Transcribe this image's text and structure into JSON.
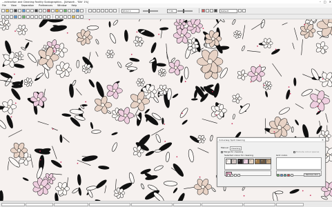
{
  "window": {
    "title": "...ectraction and Cleaning Facility Scalographics - [Artwork - 'Silk' 1%]",
    "controls": [
      "–",
      "□",
      "✕"
    ]
  },
  "menu": [
    "File",
    "View",
    "Separation",
    "Preferences",
    "Window",
    "Help"
  ],
  "toolbar": {
    "zoom_value": "63.12 1",
    "size_value": "7 34",
    "palette_select": "Default"
  },
  "dialog": {
    "title": "Colourway Spot Cleaning",
    "tabs": [
      "Manual",
      "Cleaning"
    ],
    "merge_label": "Merge for cleaning",
    "selected_label": "Selected colour for cleaning",
    "grid_label": "Grid colors",
    "no_colors_label": "Exclude colour spaces",
    "remove_label": "Remove color",
    "colors": [
      {
        "num": "1",
        "hex": "#f7f1ee"
      },
      {
        "num": "2",
        "hex": "#d4c7c4"
      },
      {
        "num": "3",
        "hex": "#2a2326"
      },
      {
        "num": "4",
        "hex": "#f0d3e4"
      },
      {
        "num": "5",
        "hex": "#e8d6c4"
      },
      {
        "num": "6",
        "hex": "#a07a4a"
      },
      {
        "num": "7",
        "hex": "#6b5842"
      },
      {
        "num": "8",
        "hex": "#c2a37e"
      }
    ],
    "selected_color": {
      "num": "6",
      "hex": "#efa9c8"
    }
  },
  "colors": {
    "background": "#f6f1ef",
    "ink": "#111111",
    "rose": "#e8d3c6",
    "pink": "#efcfe0",
    "dot": "#c9325c"
  }
}
